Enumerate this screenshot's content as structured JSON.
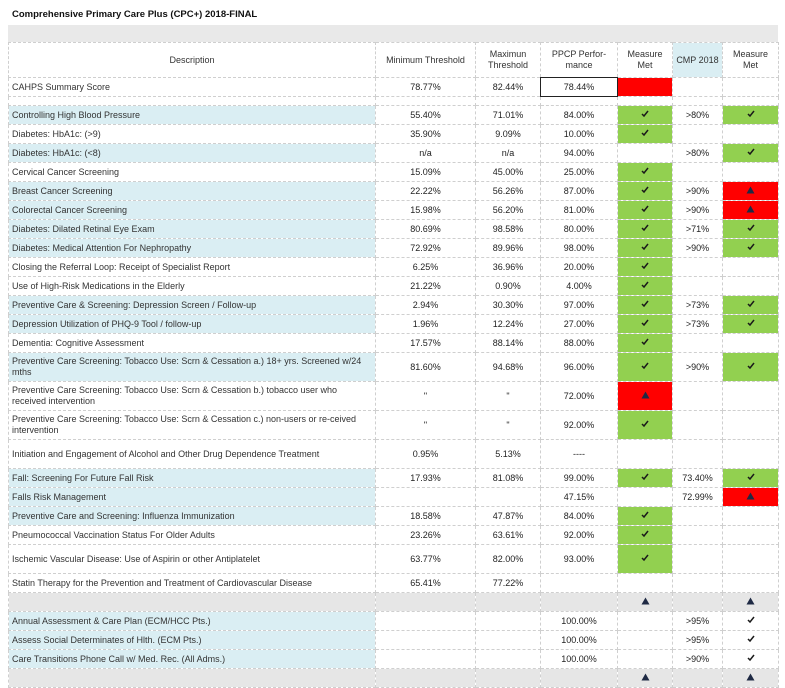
{
  "title": "Comprehensive Primary Care Plus (CPC+) 2018-FINAL",
  "headers": {
    "description": "Description",
    "min": "Minimum Threshold",
    "max": "Maximun Threshold",
    "ppcp": "PPCP  Perfor-mance",
    "met": "Measure Met",
    "cmp": "CMP 2018",
    "met2": "Measure Met"
  },
  "colors": {
    "green": "#92d050",
    "red": "#ff0000",
    "blue": "#daeef3"
  },
  "icons": {
    "check": "check-mark-icon",
    "warning": "warning-triangle-icon"
  },
  "rows": [
    {
      "desc": "CAHPS Summary Score",
      "min": "78.77%",
      "max": "82.44%",
      "ppcp": "78.44%",
      "met": "red",
      "cmp": "",
      "met2": "",
      "blue": false,
      "boxed": true
    },
    {
      "gap": true
    },
    {
      "desc": "Controlling High Blood Pressure",
      "min": "55.40%",
      "max": "71.01%",
      "ppcp": "84.00%",
      "met": "check",
      "cmp": ">80%",
      "met2": "check",
      "blue": true
    },
    {
      "desc": "Diabetes:  HbA1c: (>9)",
      "min": "35.90%",
      "max": "9.09%",
      "ppcp": "10.00%",
      "met": "check",
      "cmp": "",
      "met2": "",
      "blue": false
    },
    {
      "desc": "Diabetes:  HbA1c: (<8)",
      "min": "n/a",
      "max": "n/a",
      "ppcp": "94.00%",
      "met": "",
      "cmp": ">80%",
      "met2": "check",
      "blue": true
    },
    {
      "desc": "Cervical Cancer Screening",
      "min": "15.09%",
      "max": "45.00%",
      "ppcp": "25.00%",
      "met": "check",
      "cmp": "",
      "met2": "",
      "blue": false
    },
    {
      "desc": "Breast Cancer Screening",
      "min": "22.22%",
      "max": "56.26%",
      "ppcp": "87.00%",
      "met": "check",
      "cmp": ">90%",
      "met2": "warn",
      "blue": true
    },
    {
      "desc": "Colorectal Cancer Screening",
      "min": "15.98%",
      "max": "56.20%",
      "ppcp": "81.00%",
      "met": "check",
      "cmp": ">90%",
      "met2": "warn",
      "blue": true
    },
    {
      "desc": "Diabetes:  Dilated Retinal Eye Exam",
      "min": "80.69%",
      "max": "98.58%",
      "ppcp": "80.00%",
      "met": "check",
      "cmp": ">71%",
      "met2": "check",
      "blue": true
    },
    {
      "desc": "Diabetes: Medical Attention For Nephropathy",
      "min": "72.92%",
      "max": "89.96%",
      "ppcp": "98.00%",
      "met": "check",
      "cmp": ">90%",
      "met2": "check",
      "blue": true
    },
    {
      "desc": "Closing the Referral Loop:  Receipt of Specialist Report",
      "min": "6.25%",
      "max": "36.96%",
      "ppcp": "20.00%",
      "met": "check",
      "cmp": "",
      "met2": "",
      "blue": false
    },
    {
      "desc": "Use of High-Risk Medications in the Elderly",
      "min": "21.22%",
      "max": "0.90%",
      "ppcp": "4.00%",
      "met": "check",
      "cmp": "",
      "met2": "",
      "blue": false
    },
    {
      "desc": "Preventive Care & Screening: Depression Screen / Follow-up",
      "min": "2.94%",
      "max": "30.30%",
      "ppcp": "97.00%",
      "met": "check",
      "cmp": ">73%",
      "met2": "check",
      "blue": true
    },
    {
      "desc": "Depression Utilization of PHQ-9 Tool / follow-up",
      "min": "1.96%",
      "max": "12.24%",
      "ppcp": "27.00%",
      "met": "check",
      "cmp": ">73%",
      "met2": "check",
      "blue": true
    },
    {
      "desc": "Dementia: Cognitive Assessment",
      "min": "17.57%",
      "max": "88.14%",
      "ppcp": "88.00%",
      "met": "check",
      "cmp": "",
      "met2": "",
      "blue": false
    },
    {
      "desc": "Preventive Care Screening: Tobacco Use: Scrn & Cessation        a.)  18+ yrs. Screened w/24 mths",
      "min": "81.60%",
      "max": "94.68%",
      "ppcp": "96.00%",
      "met": "check",
      "cmp": ">90%",
      "met2": "check",
      "blue": true,
      "tall": true
    },
    {
      "desc": "Preventive Care Screening: Tobacco Use: Scrn & Cessation          b.)  tobacco user who received intervention",
      "min": "\"",
      "max": "\"",
      "ppcp": "72.00%",
      "met": "warn",
      "cmp": "",
      "met2": "",
      "blue": false,
      "tall": true
    },
    {
      "desc": "Preventive Care Screening: Tobacco Use: Scrn & Cessation          c.)  non-users or re-ceived intervention",
      "min": "\"",
      "max": "\"",
      "ppcp": "92.00%",
      "met": "check",
      "cmp": "",
      "met2": "",
      "blue": false,
      "tall": true
    },
    {
      "desc": "Initiation and Engagement of Alcohol and Other Drug Dependence Treatment",
      "min": "0.95%",
      "max": "5.13%",
      "ppcp": "----",
      "met": "",
      "cmp": "",
      "met2": "",
      "blue": false,
      "tall": true
    },
    {
      "desc": "Fall:  Screening For Future Fall Risk",
      "min": "17.93%",
      "max": "81.08%",
      "ppcp": "99.00%",
      "met": "check",
      "cmp": "73.40%",
      "met2": "check",
      "blue": true
    },
    {
      "desc": "Falls Risk Management",
      "min": "",
      "max": "",
      "ppcp": "47.15%",
      "met": "",
      "cmp": "72.99%",
      "met2": "warn",
      "blue": true
    },
    {
      "desc": "Preventive Care and Screening: Influenza Immunization",
      "min": "18.58%",
      "max": "47.87%",
      "ppcp": "84.00%",
      "met": "check",
      "cmp": "",
      "met2": "",
      "blue": true
    },
    {
      "desc": "Pneumococcal Vaccination Status For Older Adults",
      "min": "23.26%",
      "max": "63.61%",
      "ppcp": "92.00%",
      "met": "check",
      "cmp": "",
      "met2": "",
      "blue": false
    },
    {
      "desc": "Ischemic Vascular Disease: Use of Aspirin or other Antiplatelet",
      "min": "63.77%",
      "max": "82.00%",
      "ppcp": "93.00%",
      "met": "check",
      "cmp": "",
      "met2": "",
      "blue": false,
      "tall": true
    },
    {
      "desc": "Statin Therapy for the Prevention and Treatment of Cardiovascular Disease",
      "min": "65.41%",
      "max": "77.22%",
      "ppcp": "",
      "met": "",
      "cmp": "",
      "met2": "",
      "blue": false
    },
    {
      "band": true,
      "met": "tri",
      "met2": "tri"
    },
    {
      "desc": "Annual Assessment & Care Plan (ECM/HCC Pts.)",
      "min": "",
      "max": "",
      "ppcp": "100.00%",
      "met": "",
      "cmp": ">95%",
      "met2": "plaincheck",
      "blue": true
    },
    {
      "desc": "Assess Social Determinates of Hlth. (ECM Pts.)",
      "min": "",
      "max": "",
      "ppcp": "100.00%",
      "met": "",
      "cmp": ">95%",
      "met2": "plaincheck",
      "blue": true
    },
    {
      "desc": "Care Transitions Phone Call w/ Med. Rec. (All Adms.)",
      "min": "",
      "max": "",
      "ppcp": "100.00%",
      "met": "",
      "cmp": ">90%",
      "met2": "plaincheck",
      "blue": true
    },
    {
      "band": true,
      "met": "tri",
      "met2": "tri"
    }
  ]
}
